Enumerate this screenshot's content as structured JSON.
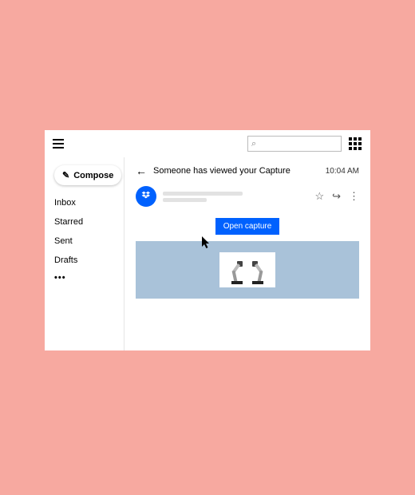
{
  "topbar": {
    "search_placeholder": ""
  },
  "sidebar": {
    "compose_label": "Compose",
    "items": [
      {
        "label": "Inbox"
      },
      {
        "label": "Starred"
      },
      {
        "label": "Sent"
      },
      {
        "label": "Drafts"
      }
    ],
    "more_label": "•••"
  },
  "message": {
    "subject": "Someone has viewed your Capture",
    "time": "10:04 AM",
    "open_button_label": "Open capture",
    "avatar_icon": "dropbox-logo"
  },
  "icons": {
    "star": "☆",
    "reply": "↪",
    "more": "⋮",
    "back": "←",
    "search": "⌕",
    "pencil": "✎"
  },
  "colors": {
    "accent": "#0061fe",
    "bg": "#f7a9a0"
  }
}
